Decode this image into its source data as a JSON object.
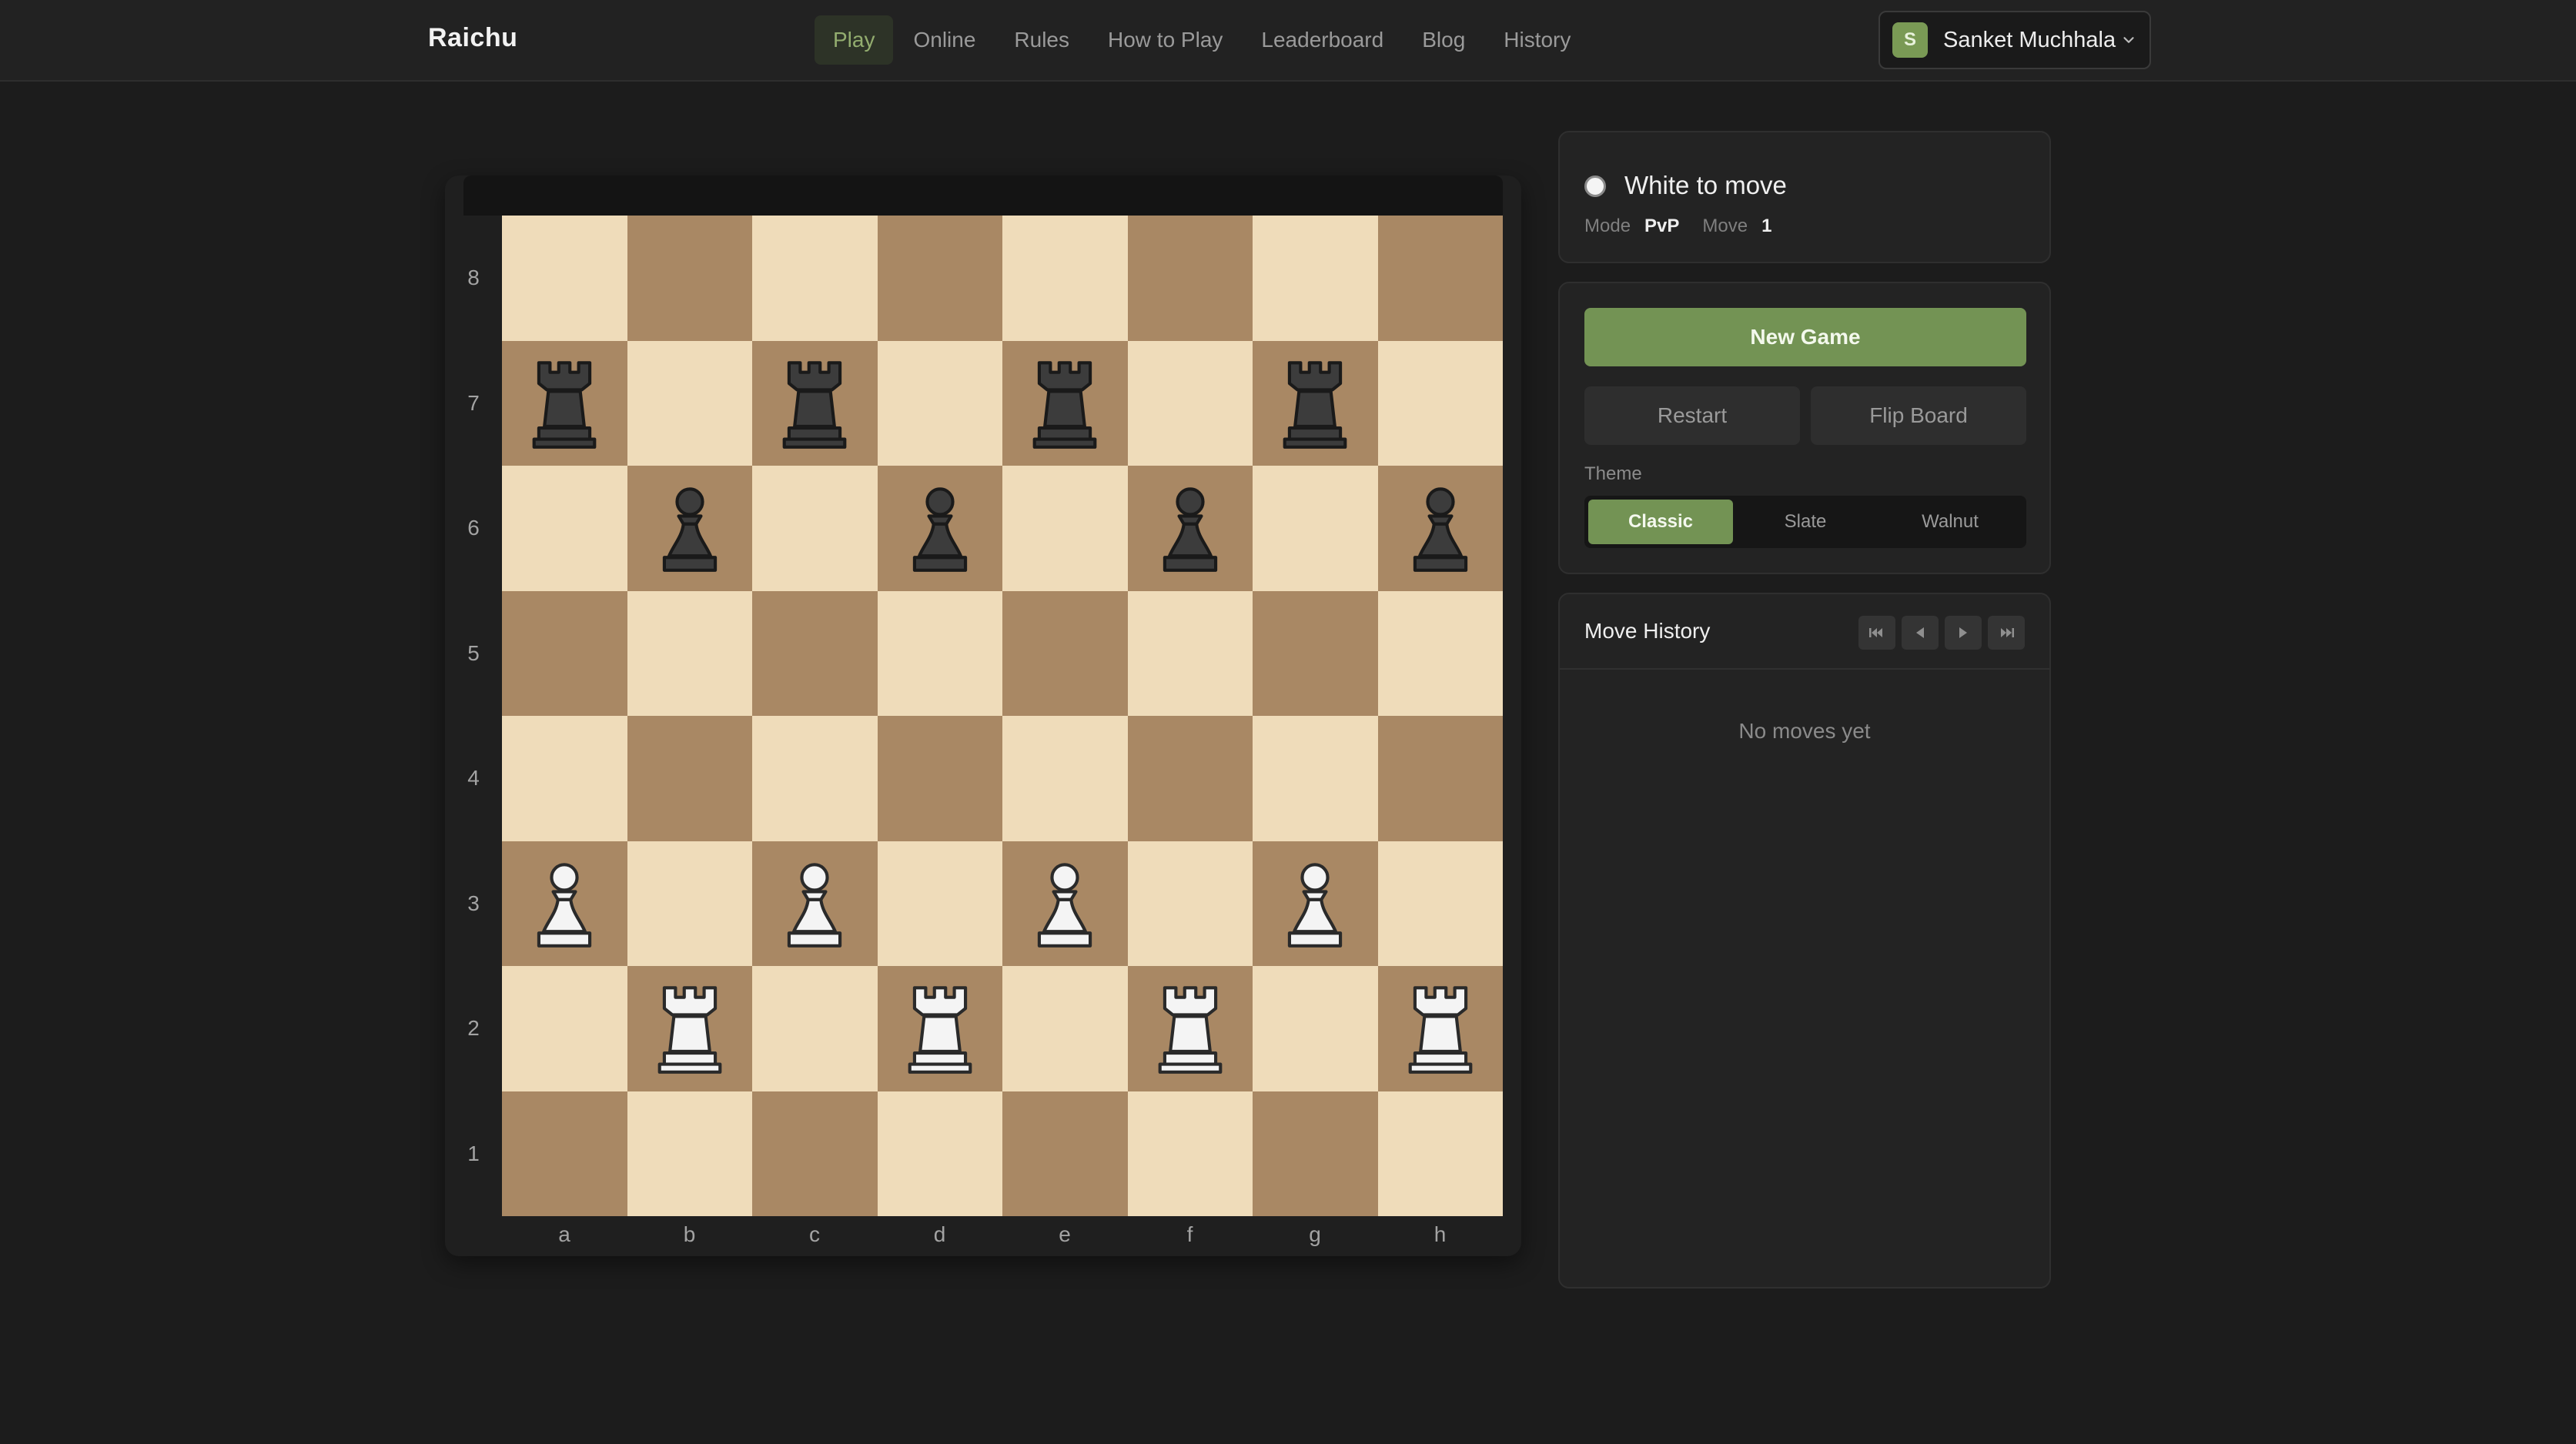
{
  "app": {
    "brand": "Raichu"
  },
  "nav": [
    {
      "label": "Play",
      "active": true
    },
    {
      "label": "Online"
    },
    {
      "label": "Rules"
    },
    {
      "label": "How to Play"
    },
    {
      "label": "Leaderboard"
    },
    {
      "label": "Blog"
    },
    {
      "label": "History"
    }
  ],
  "user": {
    "initial": "S",
    "name": "Sanket Muchhala"
  },
  "board": {
    "ranks": [
      "8",
      "7",
      "6",
      "5",
      "4",
      "3",
      "2",
      "1"
    ],
    "files": [
      "a",
      "b",
      "c",
      "d",
      "e",
      "f",
      "g",
      "h"
    ],
    "pieces": [
      {
        "square": "a7",
        "color": "black",
        "type": "rook"
      },
      {
        "square": "c7",
        "color": "black",
        "type": "rook"
      },
      {
        "square": "e7",
        "color": "black",
        "type": "rook"
      },
      {
        "square": "g7",
        "color": "black",
        "type": "rook"
      },
      {
        "square": "b6",
        "color": "black",
        "type": "pawn"
      },
      {
        "square": "d6",
        "color": "black",
        "type": "pawn"
      },
      {
        "square": "f6",
        "color": "black",
        "type": "pawn"
      },
      {
        "square": "h6",
        "color": "black",
        "type": "pawn"
      },
      {
        "square": "a3",
        "color": "white",
        "type": "pawn"
      },
      {
        "square": "c3",
        "color": "white",
        "type": "pawn"
      },
      {
        "square": "e3",
        "color": "white",
        "type": "pawn"
      },
      {
        "square": "g3",
        "color": "white",
        "type": "pawn"
      },
      {
        "square": "b2",
        "color": "white",
        "type": "rook"
      },
      {
        "square": "d2",
        "color": "white",
        "type": "rook"
      },
      {
        "square": "f2",
        "color": "white",
        "type": "rook"
      },
      {
        "square": "h2",
        "color": "white",
        "type": "rook"
      }
    ],
    "colors": {
      "light": "#efdcba",
      "dark": "#a98864"
    }
  },
  "status": {
    "turn_text": "White to move",
    "mode_label": "Mode",
    "mode_value": "PvP",
    "move_label": "Move",
    "move_value": "1"
  },
  "controls": {
    "new_game": "New Game",
    "restart": "Restart",
    "flip_board": "Flip Board",
    "theme_label": "Theme",
    "themes": [
      {
        "label": "Classic",
        "active": true
      },
      {
        "label": "Slate"
      },
      {
        "label": "Walnut"
      }
    ]
  },
  "history": {
    "title": "Move History",
    "empty_text": "No moves yet",
    "nav_icons": [
      "skip-first-icon",
      "step-back-icon",
      "step-forward-icon",
      "skip-last-icon"
    ]
  },
  "theme_colors": {
    "accent": "#739354",
    "background": "#1c1c1c"
  }
}
